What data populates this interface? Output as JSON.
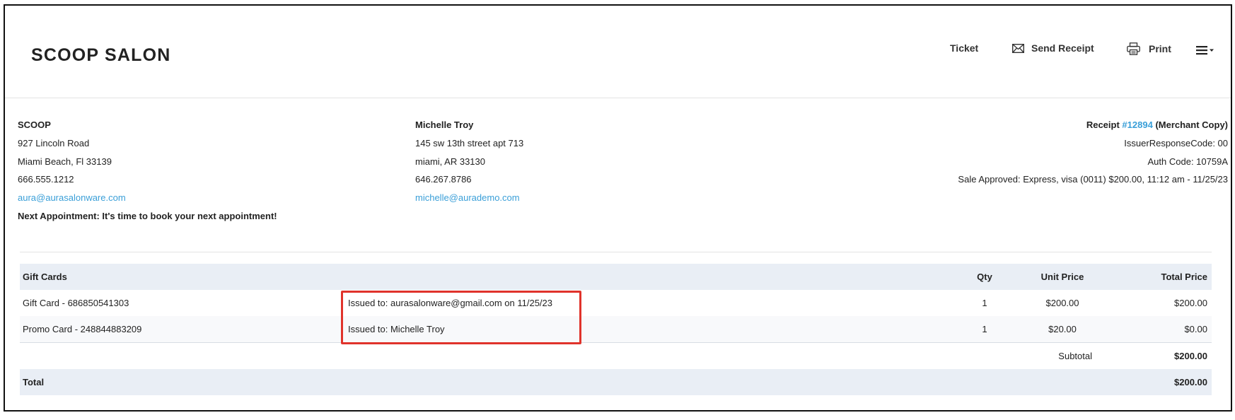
{
  "header": {
    "logo": "SCOOP SALON",
    "nav": {
      "ticket": "Ticket",
      "send_receipt": "Send Receipt",
      "print": "Print"
    }
  },
  "merchant": {
    "name": "SCOOP",
    "address1": "927 Lincoln Road",
    "address2": "Miami Beach, Fl 33139",
    "phone": "666.555.1212",
    "email": "aura@aurasalonware.com",
    "next_appointment": "Next Appointment: It's time to book your next appointment!"
  },
  "customer": {
    "name": "Michelle Troy",
    "address1": "145 sw 13th street apt 713",
    "address2": "miami, AR 33130",
    "phone": "646.267.8786",
    "email": "michelle@aurademo.com"
  },
  "receipt": {
    "label": "Receipt",
    "number": "#12894",
    "copy": "(Merchant Copy)",
    "issuer_response": "IssuerResponseCode: 00",
    "auth_code": "Auth Code: 10759A",
    "sale": "Sale Approved: Express, visa (0011) $200.00, 11:12 am - 11/25/23"
  },
  "table": {
    "headers": {
      "item": "Gift Cards",
      "qty": "Qty",
      "unit_price": "Unit Price",
      "total_price": "Total Price"
    },
    "rows": [
      {
        "item": "Gift Card - 686850541303",
        "note": "Issued to: aurasalonware@gmail.com on 11/25/23",
        "qty": "1",
        "unit_price": "$200.00",
        "total_price": "$200.00"
      },
      {
        "item": "Promo Card - 248844883209",
        "note": "Issued to: Michelle Troy",
        "qty": "1",
        "unit_price": "$20.00",
        "total_price": "$0.00"
      }
    ],
    "subtotal_label": "Subtotal",
    "subtotal_value": "$200.00",
    "total_label": "Total",
    "total_value": "$200.00"
  },
  "colors": {
    "link": "#3a9fd8",
    "highlight": "#e0332b",
    "header_row_bg": "#e9eef5"
  }
}
